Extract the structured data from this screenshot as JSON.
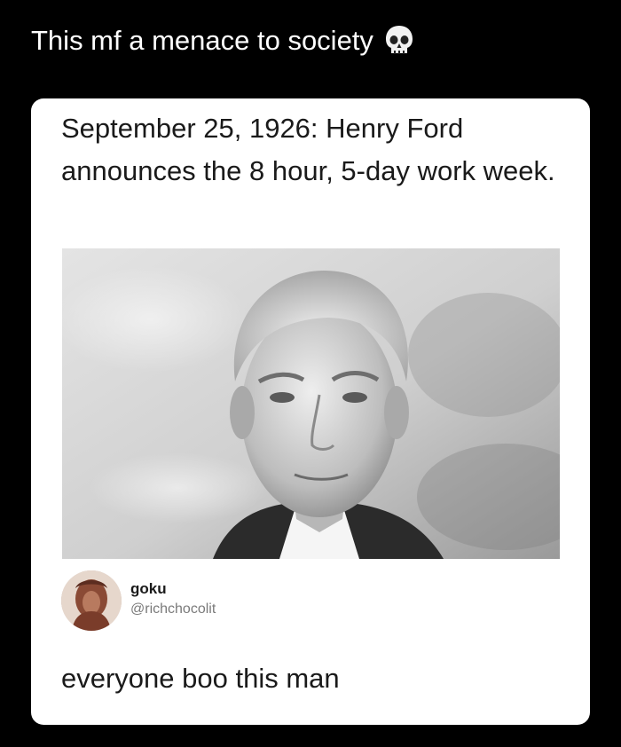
{
  "caption": {
    "text": "This mf a menace to society",
    "emoji_icon": "skull-icon"
  },
  "post": {
    "text": "September 25, 1926: Henry Ford announces the 8 hour, 5-day work week."
  },
  "photo": {
    "description_icon": "portrait-photo"
  },
  "reply": {
    "display_name": "goku",
    "handle": "@richchocolit",
    "text": "everyone boo this man"
  },
  "colors": {
    "background": "#000000",
    "card": "#ffffff",
    "text": "#1a1a1a",
    "muted": "#7a7a7a"
  }
}
